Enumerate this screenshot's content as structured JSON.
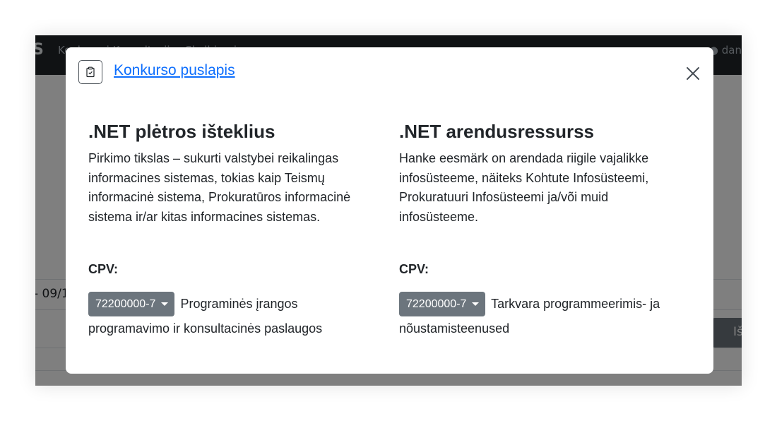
{
  "background": {
    "nav": {
      "brand": "S",
      "links": "Konkursai    Konsultacijos    Skelbimai",
      "user": "dan"
    },
    "date_fragment": "- 09/1",
    "button_fragment": "Iš"
  },
  "modal": {
    "header": {
      "link_label": "Konkurso puslapis",
      "icon": "clipboard-check-icon",
      "close_icon": "close-icon"
    },
    "left": {
      "title": ".NET plėtros išteklius",
      "description": "Pirkimo tikslas – sukurti valstybei reikalingas informacines sistemas, tokias kaip Teismų informacinė sistema, Prokuratūros informacinė sistema ir/ar kitas informacines sistemas.",
      "cpv_label": "CPV:",
      "cpv_code": "72200000-7",
      "cpv_text": "Programinės įrangos programavimo ir konsultacinės paslaugos"
    },
    "right": {
      "title": ".NET arendusressurss",
      "description": "Hanke eesmärk on arendada riigile vajalikke infosüsteeme, näiteks Kohtute Infosüsteemi, Prokuratuuri Infosüsteemi ja/või muid infosüsteeme.",
      "cpv_label": "CPV:",
      "cpv_code": "72200000-7",
      "cpv_text": "Tarkvara programmeerimis- ja nõustamisteenused"
    }
  },
  "colors": {
    "link": "#0d6efd",
    "dropdown": "#6c757d",
    "navbar": "#212529",
    "text": "#212529"
  }
}
